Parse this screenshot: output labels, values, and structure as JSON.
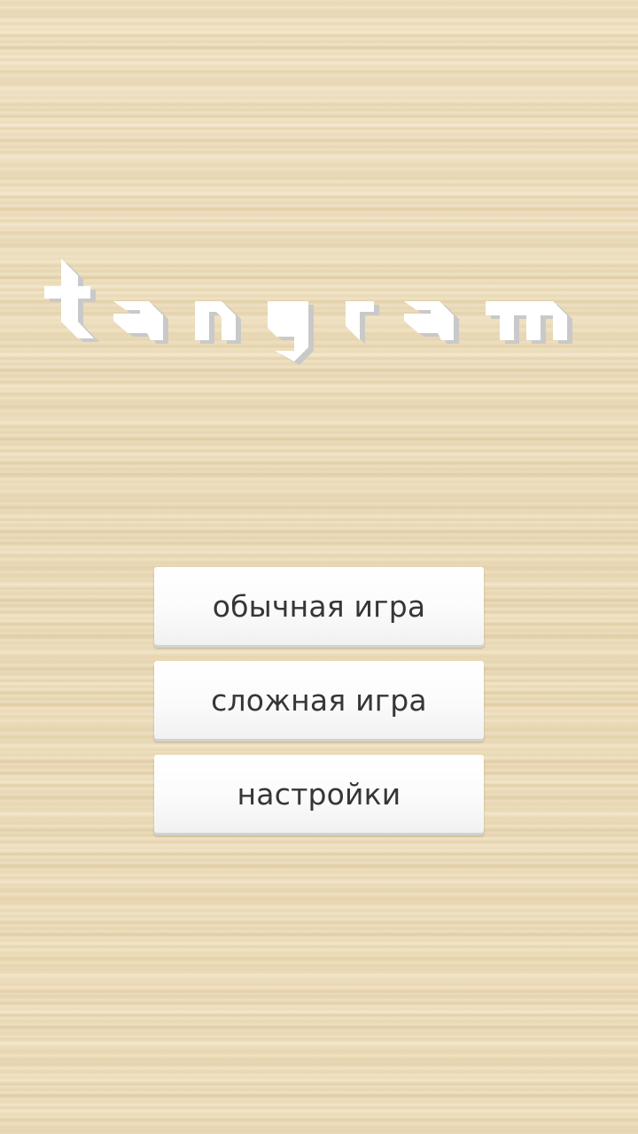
{
  "logo": {
    "text": "tangram"
  },
  "menu": {
    "items": [
      {
        "label": "обычная игра"
      },
      {
        "label": "сложная игра"
      },
      {
        "label": "настройки"
      }
    ]
  },
  "colors": {
    "background": "#eddcb8",
    "button": "#ffffff",
    "button_text": "#363636",
    "logo": "#ffffff",
    "logo_shadow": "#c9c9c9"
  }
}
